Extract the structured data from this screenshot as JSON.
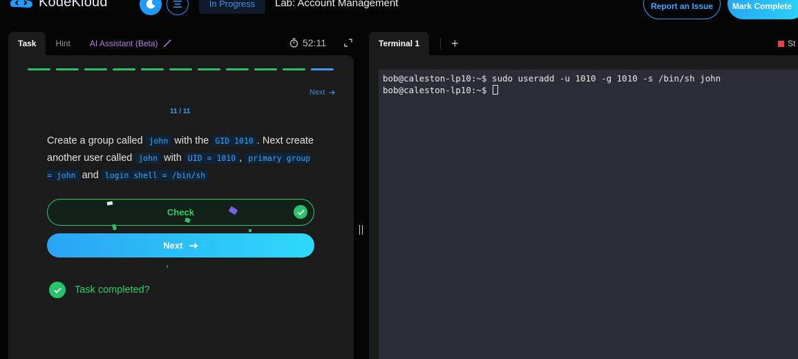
{
  "header": {
    "logo_text": "KodeKloud",
    "status": "In Progress",
    "lab_title": "Lab: Account Management",
    "report_label": "Report an Issue",
    "complete_label": "Mark Complete"
  },
  "task_panel": {
    "tabs": [
      "Task",
      "Hint",
      "AI Assistant (Beta)"
    ],
    "timer": "52:11",
    "progress_total": 11,
    "progress_current": 11,
    "next_link": "Next",
    "step_counter": "11 / 11",
    "description": {
      "t1": "Create a group called ",
      "c1": "john",
      "t2": " with the ",
      "c2": "GID 1010",
      "t3": ". Next create another user called ",
      "c3": "john",
      "t4": " with ",
      "c4": "UID = 1010",
      "t5": ", ",
      "c5": "primary group = john",
      "t6": " and ",
      "c6": "login shell = /bin/sh"
    },
    "check_label": "Check",
    "next_label": "Next",
    "completed_label": "Task completed?"
  },
  "terminal": {
    "tab_label": "Terminal 1",
    "add_tab": "+",
    "stop_label": "St",
    "lines": [
      "bob@caleston-lp10:~$ sudo useradd -u 1010 -g 1010 -s /bin/sh john",
      "bob@caleston-lp10:~$ "
    ]
  },
  "colors": {
    "accent_blue": "#1f9bff",
    "success_green": "#2ecf6c",
    "ai_purple": "#b67ee9",
    "terminal_bg": "#2b2c36"
  }
}
